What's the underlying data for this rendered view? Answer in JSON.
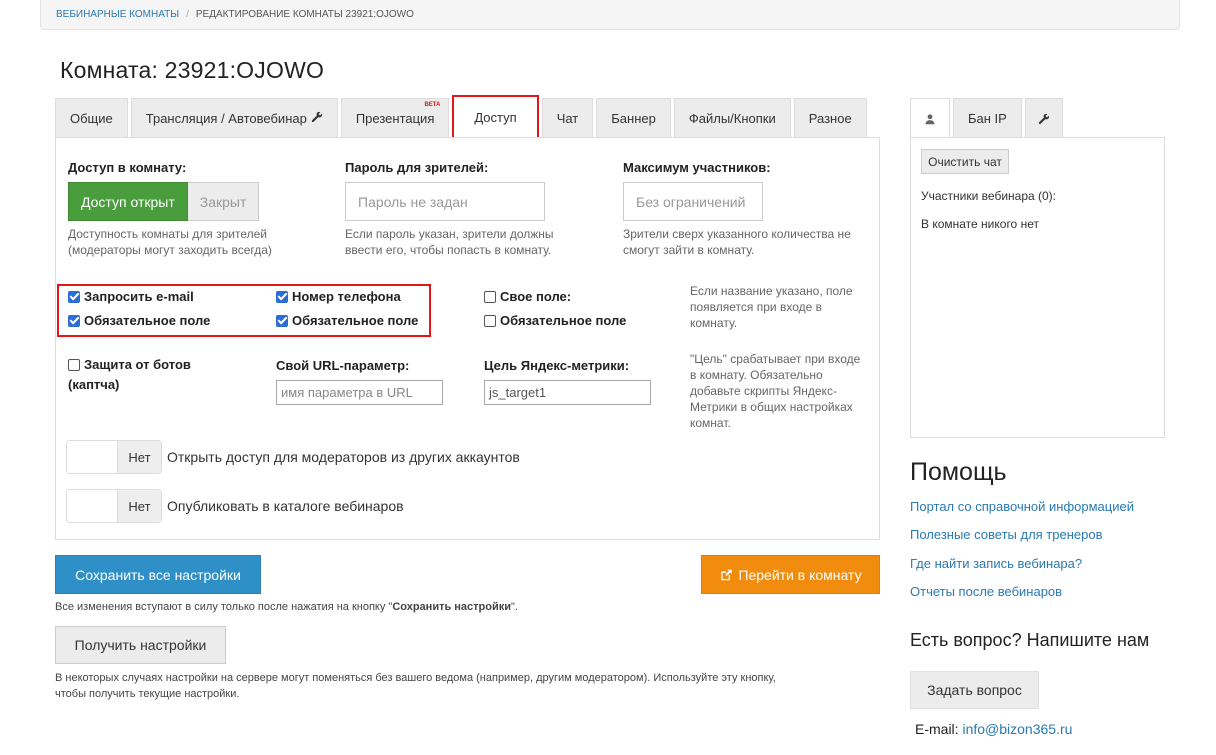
{
  "breadcrumb": {
    "home": "ВЕБИНАРНЫЕ КОМНАТЫ",
    "separator": "/",
    "current": "РЕДАКТИРОВАНИЕ КОМНАТЫ 23921:OJOWO"
  },
  "page_title": "Комната: 23921:OJOWO",
  "tabs": [
    {
      "label": "Общие"
    },
    {
      "label": "Трансляция / Автовебинар",
      "icon": "wrench-icon"
    },
    {
      "label": "Презентация",
      "badge": "BETA"
    },
    {
      "label": "Доступ",
      "active": true
    },
    {
      "label": "Чат"
    },
    {
      "label": "Баннер"
    },
    {
      "label": "Файлы/Кнопки"
    },
    {
      "label": "Разное"
    }
  ],
  "access": {
    "label": "Доступ в комнату:",
    "open_label": "Доступ открыт",
    "closed_label": "Закрыт",
    "hint": [
      "Доступность комнаты для зрителей",
      "(модераторы могут заходить всегда)"
    ]
  },
  "password": {
    "label": "Пароль для зрителей:",
    "placeholder": "Пароль не задан",
    "hint": [
      "Если пароль указан, зрители должны",
      "ввести его, чтобы попасть в комнату."
    ]
  },
  "max_participants": {
    "label": "Максимум участников:",
    "placeholder": "Без ограничений",
    "hint": [
      "Зрители сверх указанного количества не",
      "смогут зайти в комнату."
    ]
  },
  "checkboxes": {
    "email": "Запросить e-mail",
    "email_required": "Обязательное поле",
    "phone": "Номер телефона",
    "phone_required": "Обязательное поле",
    "custom": "Свое поле:",
    "custom_required": "Обязательное поле",
    "captcha_line1": "Защита от ботов",
    "captcha_line2": "(каптча)"
  },
  "custom_hint": [
    "Если название указано, поле",
    "появляется при входе в",
    "комнату."
  ],
  "url_param": {
    "label": "Свой URL-параметр:",
    "placeholder": "имя параметра в URL"
  },
  "metrika": {
    "label": "Цель Яндекс-метрики:",
    "value": "js_target1"
  },
  "metrika_hint": [
    "\"Цель\" срабатывает при входе",
    "в комнату. Обязательно",
    "добавьте скрипты Яндекс-",
    "Метрики в общих настройках",
    "комнат."
  ],
  "toggles": [
    {
      "state": "Нет",
      "label": "Открыть доступ для модераторов из других аккаунтов"
    },
    {
      "state": "Нет",
      "label": "Опубликовать в каталоге вебинаров"
    }
  ],
  "save_button": "Сохранить все настройки",
  "go_button": "Перейти в комнату",
  "save_note_prefix": "Все изменения вступают в силу только после нажатия на кнопку \"",
  "save_note_bold": "Сохранить настройки",
  "save_note_suffix": "\".",
  "get_button": "Получить настройки",
  "get_note": [
    "В некоторых случаях настройки на сервере могут поменяться без вашего ведома (например, другим модератором). Используйте эту кнопку,",
    "чтобы получить текущие настройки."
  ],
  "right_tabs": [
    {
      "icon": "user-icon",
      "active": true
    },
    {
      "label": "Бан IP"
    },
    {
      "icon": "wrench-icon"
    }
  ],
  "clear_chat": "Очистить чат",
  "participants_label": "Участники вебинара (0):",
  "no_one": "В комнате никого нет",
  "help": {
    "title": "Помощь",
    "links": [
      "Портал со справочной информацией",
      "Полезные советы для тренеров",
      "Где найти запись вебинара?",
      "Отчеты после вебинаров"
    ]
  },
  "ask": {
    "title": "Есть вопрос? Напишите нам",
    "button": "Задать вопрос",
    "email_label": "E-mail:",
    "email": "info@bizon365.ru"
  },
  "colors": {
    "accent_blue": "#2f8fc7",
    "green": "#4a9d3c",
    "orange": "#f28c0e",
    "highlight_red": "#e0161a",
    "link": "#2a7ab0"
  }
}
